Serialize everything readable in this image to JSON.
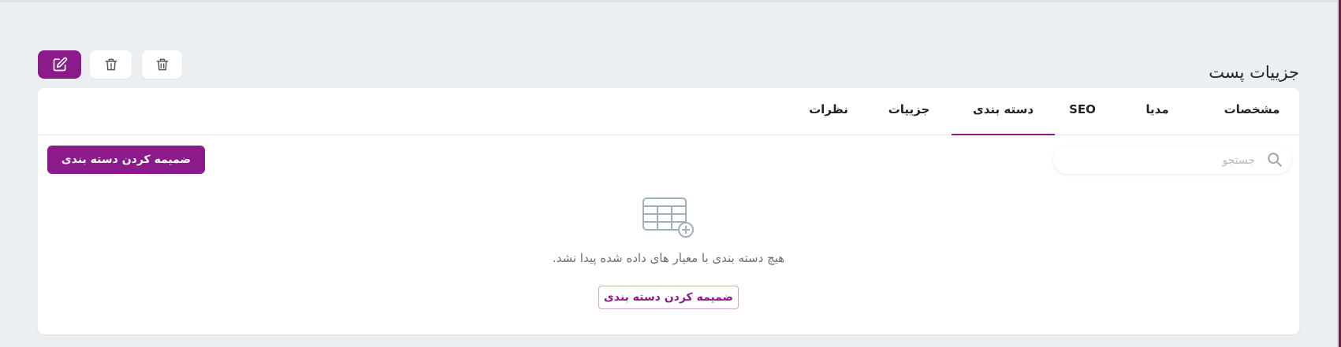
{
  "page": {
    "title": "جزییات پست"
  },
  "header_actions": {
    "edit_icon": "edit-icon",
    "archive_icon": "archive-alert-icon",
    "delete_icon": "trash-icon"
  },
  "tabs": [
    {
      "label": "مشخصات",
      "active": false
    },
    {
      "label": "مدیا",
      "active": false
    },
    {
      "label": "SEO",
      "active": false
    },
    {
      "label": "دسته بندی",
      "active": true
    },
    {
      "label": "جزییات",
      "active": false
    },
    {
      "label": "نظرات",
      "active": false
    }
  ],
  "search": {
    "placeholder": "جستجو",
    "icon": "search-icon"
  },
  "attach_button_top": "ضمیمه کردن دسته بندی",
  "empty_state": {
    "icon": "table-add-icon",
    "message": "هیچ دسته بندی با معیار های داده شده پیدا نشد.",
    "action_label": "ضمیمه کردن دسته بندی"
  },
  "colors": {
    "primary": "#8b1a8a",
    "background": "#eceff2",
    "card": "#ffffff"
  }
}
